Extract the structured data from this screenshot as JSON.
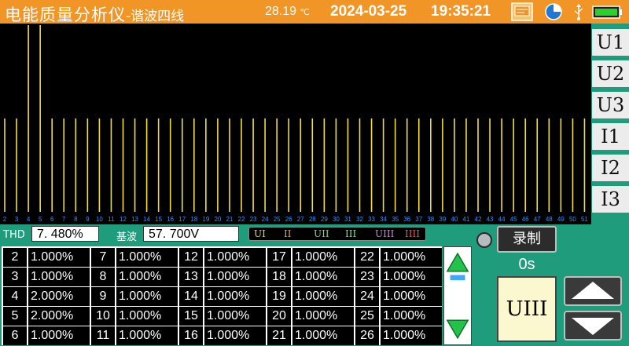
{
  "header": {
    "title_main": "电能质量分析仪",
    "title_sub": "-谐波四线",
    "temperature": "28.19",
    "temperature_unit": "℃",
    "date": "2024-03-25",
    "time": "19:35:21"
  },
  "channels": [
    "U1",
    "U2",
    "U3",
    "I1",
    "I2",
    "I3"
  ],
  "chart_data": {
    "type": "bar",
    "categories": [
      "2",
      "3",
      "4",
      "5",
      "6",
      "7",
      "8",
      "9",
      "10",
      "11",
      "12",
      "13",
      "14",
      "15",
      "16",
      "17",
      "18",
      "19",
      "20",
      "21",
      "22",
      "23",
      "24",
      "25",
      "26",
      "27",
      "28",
      "29",
      "30",
      "31",
      "32",
      "33",
      "34",
      "35",
      "36",
      "37",
      "38",
      "39",
      "40",
      "41",
      "42",
      "43",
      "44",
      "45",
      "46",
      "47",
      "48",
      "49",
      "50",
      "51"
    ],
    "values": [
      1,
      1,
      2,
      2,
      1,
      1,
      1,
      1,
      1,
      1,
      1,
      1,
      1,
      1,
      1,
      1,
      1,
      1,
      1,
      1,
      1,
      1,
      1,
      1,
      1,
      1,
      1,
      1,
      1,
      1,
      1,
      1,
      1,
      1,
      1,
      1,
      1,
      1,
      1,
      1,
      1,
      1,
      1,
      1,
      1,
      1,
      1,
      1,
      1,
      1
    ],
    "ylim": [
      0,
      2
    ],
    "colors": {
      "bar": "#f2e03a",
      "axis_text": "#2e8fff",
      "background": "#000000"
    }
  },
  "status": {
    "thd_label": "THD",
    "thd_value": "7. 480%",
    "fund_label": "基波",
    "fund_value": "57. 700V"
  },
  "legend": [
    {
      "label": "UI",
      "color": "#e8d44a"
    },
    {
      "label": "II",
      "color": "#e8a040"
    },
    {
      "label": "UII",
      "color": "#7ed67e"
    },
    {
      "label": "III",
      "color": "#7ee87e"
    },
    {
      "label": "UIII",
      "color": "#d080d8"
    },
    {
      "label": "IIII",
      "color": "#f05050"
    }
  ],
  "table": {
    "columns": [
      [
        {
          "n": "2",
          "v": "1.000%"
        },
        {
          "n": "3",
          "v": "1.000%"
        },
        {
          "n": "4",
          "v": "2.000%"
        },
        {
          "n": "5",
          "v": "2.000%"
        },
        {
          "n": "6",
          "v": "1.000%"
        }
      ],
      [
        {
          "n": "7",
          "v": "1.000%"
        },
        {
          "n": "8",
          "v": "1.000%"
        },
        {
          "n": "9",
          "v": "1.000%"
        },
        {
          "n": "10",
          "v": "1.000%"
        },
        {
          "n": "11",
          "v": "1.000%"
        }
      ],
      [
        {
          "n": "12",
          "v": "1.000%"
        },
        {
          "n": "13",
          "v": "1.000%"
        },
        {
          "n": "14",
          "v": "1.000%"
        },
        {
          "n": "15",
          "v": "1.000%"
        },
        {
          "n": "16",
          "v": "1.000%"
        }
      ],
      [
        {
          "n": "17",
          "v": "1.000%"
        },
        {
          "n": "18",
          "v": "1.000%"
        },
        {
          "n": "19",
          "v": "1.000%"
        },
        {
          "n": "20",
          "v": "1.000%"
        },
        {
          "n": "21",
          "v": "1.000%"
        }
      ],
      [
        {
          "n": "22",
          "v": "1.000%"
        },
        {
          "n": "23",
          "v": "1.000%"
        },
        {
          "n": "24",
          "v": "1.000%"
        },
        {
          "n": "25",
          "v": "1.000%"
        },
        {
          "n": "26",
          "v": "1.000%"
        }
      ]
    ]
  },
  "record": {
    "label": "录制",
    "elapsed": "0s"
  },
  "selected_channel": "UIII",
  "icons": {
    "screen": "screen-icon",
    "clock": "clock-icon",
    "usb": "usb-icon",
    "battery": "battery-icon"
  }
}
